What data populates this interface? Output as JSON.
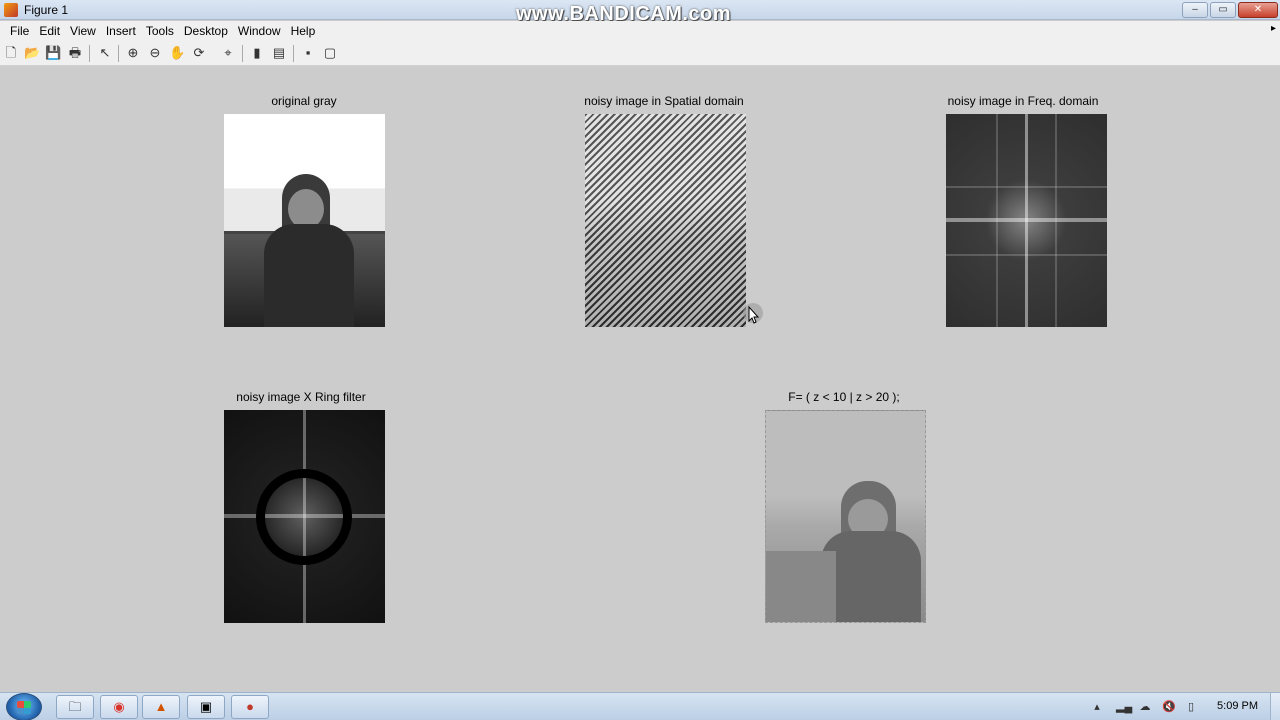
{
  "window": {
    "title": "Figure 1",
    "watermark": "www.BANDICAM.com",
    "controls": {
      "minimize": "–",
      "maximize": "▭",
      "close": "✕"
    }
  },
  "menu": {
    "items": [
      "File",
      "Edit",
      "View",
      "Insert",
      "Tools",
      "Desktop",
      "Window",
      "Help"
    ],
    "overflow": "▸"
  },
  "toolbar": {
    "buttons": [
      {
        "icon": "new-file-icon",
        "glyph": "🗋"
      },
      {
        "icon": "open-folder-icon",
        "glyph": "📂"
      },
      {
        "icon": "save-icon",
        "glyph": "💾"
      },
      {
        "icon": "print-icon",
        "glyph": "🖶"
      },
      {
        "icon": "edit-plot-arrow-icon",
        "glyph": "↖"
      },
      {
        "icon": "zoom-in-icon",
        "glyph": "⊕"
      },
      {
        "icon": "zoom-out-icon",
        "glyph": "⊖"
      },
      {
        "icon": "pan-hand-icon",
        "glyph": "✋"
      },
      {
        "icon": "rotate-3d-icon",
        "glyph": "⟳"
      },
      {
        "icon": "data-cursor-icon",
        "glyph": "⌖"
      },
      {
        "icon": "colorbar-icon",
        "glyph": "▮"
      },
      {
        "icon": "legend-icon",
        "glyph": "▤"
      },
      {
        "icon": "hide-plot-tools-icon",
        "glyph": "▪"
      },
      {
        "icon": "show-plot-tools-icon",
        "glyph": "▢"
      }
    ]
  },
  "subplots": [
    {
      "title": "original gray"
    },
    {
      "title": "noisy image in Spatial domain"
    },
    {
      "title": "noisy image in Freq. domain"
    },
    {
      "title": "noisy image X Ring filter"
    },
    {
      "title": "F= ( z < 10 | z > 20 );"
    }
  ],
  "taskbar": {
    "apps": [
      {
        "name": "file-explorer",
        "glyph": "🗀"
      },
      {
        "name": "chrome",
        "glyph": "◉"
      },
      {
        "name": "matlab",
        "glyph": "▲"
      },
      {
        "name": "window-app",
        "glyph": "▣"
      },
      {
        "name": "bandicam",
        "glyph": "●"
      }
    ],
    "tray": {
      "clock": "5:09 PM"
    }
  }
}
